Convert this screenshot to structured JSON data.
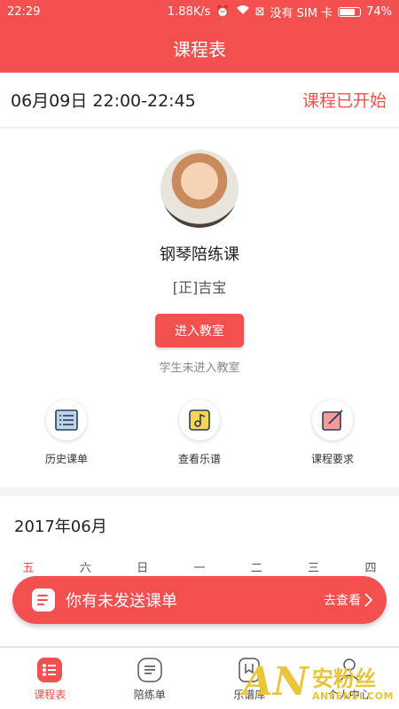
{
  "status_bar": {
    "time": "22:29",
    "network_speed": "1.88K/s",
    "sim_text": "没有 SIM 卡",
    "battery": "74%"
  },
  "app_bar": {
    "title": "课程表"
  },
  "lesson": {
    "datetime": "06月09日 22:00-22:45",
    "status": "课程已开始",
    "course_name": "钢琴陪练课",
    "student": "[正]吉宝",
    "enter_button": "进入教室",
    "enter_hint": "学生未进入教室"
  },
  "actions": [
    {
      "label": "历史课单",
      "icon": "list-icon"
    },
    {
      "label": "查看乐谱",
      "icon": "music-note-icon"
    },
    {
      "label": "课程要求",
      "icon": "pen-note-icon"
    }
  ],
  "calendar": {
    "month": "2017年06月",
    "weekdays": [
      "五",
      "六",
      "日",
      "一",
      "二",
      "三",
      "四"
    ],
    "active_weekday": "五"
  },
  "toast": {
    "text": "你有未发送课单",
    "link": "去查看"
  },
  "tabs": [
    {
      "label": "课程表",
      "icon": "schedule-icon",
      "active": true
    },
    {
      "label": "陪练单",
      "icon": "document-icon",
      "active": false
    },
    {
      "label": "乐谱库",
      "icon": "bookmark-icon",
      "active": false
    },
    {
      "label": "个人中心",
      "icon": "person-icon",
      "active": false
    }
  ],
  "watermark": {
    "big": "AN",
    "cn": "安粉丝",
    "en": "ANFENSI.COM"
  },
  "colors": {
    "accent": "#f4504f",
    "watermark": "#e8c53a"
  }
}
